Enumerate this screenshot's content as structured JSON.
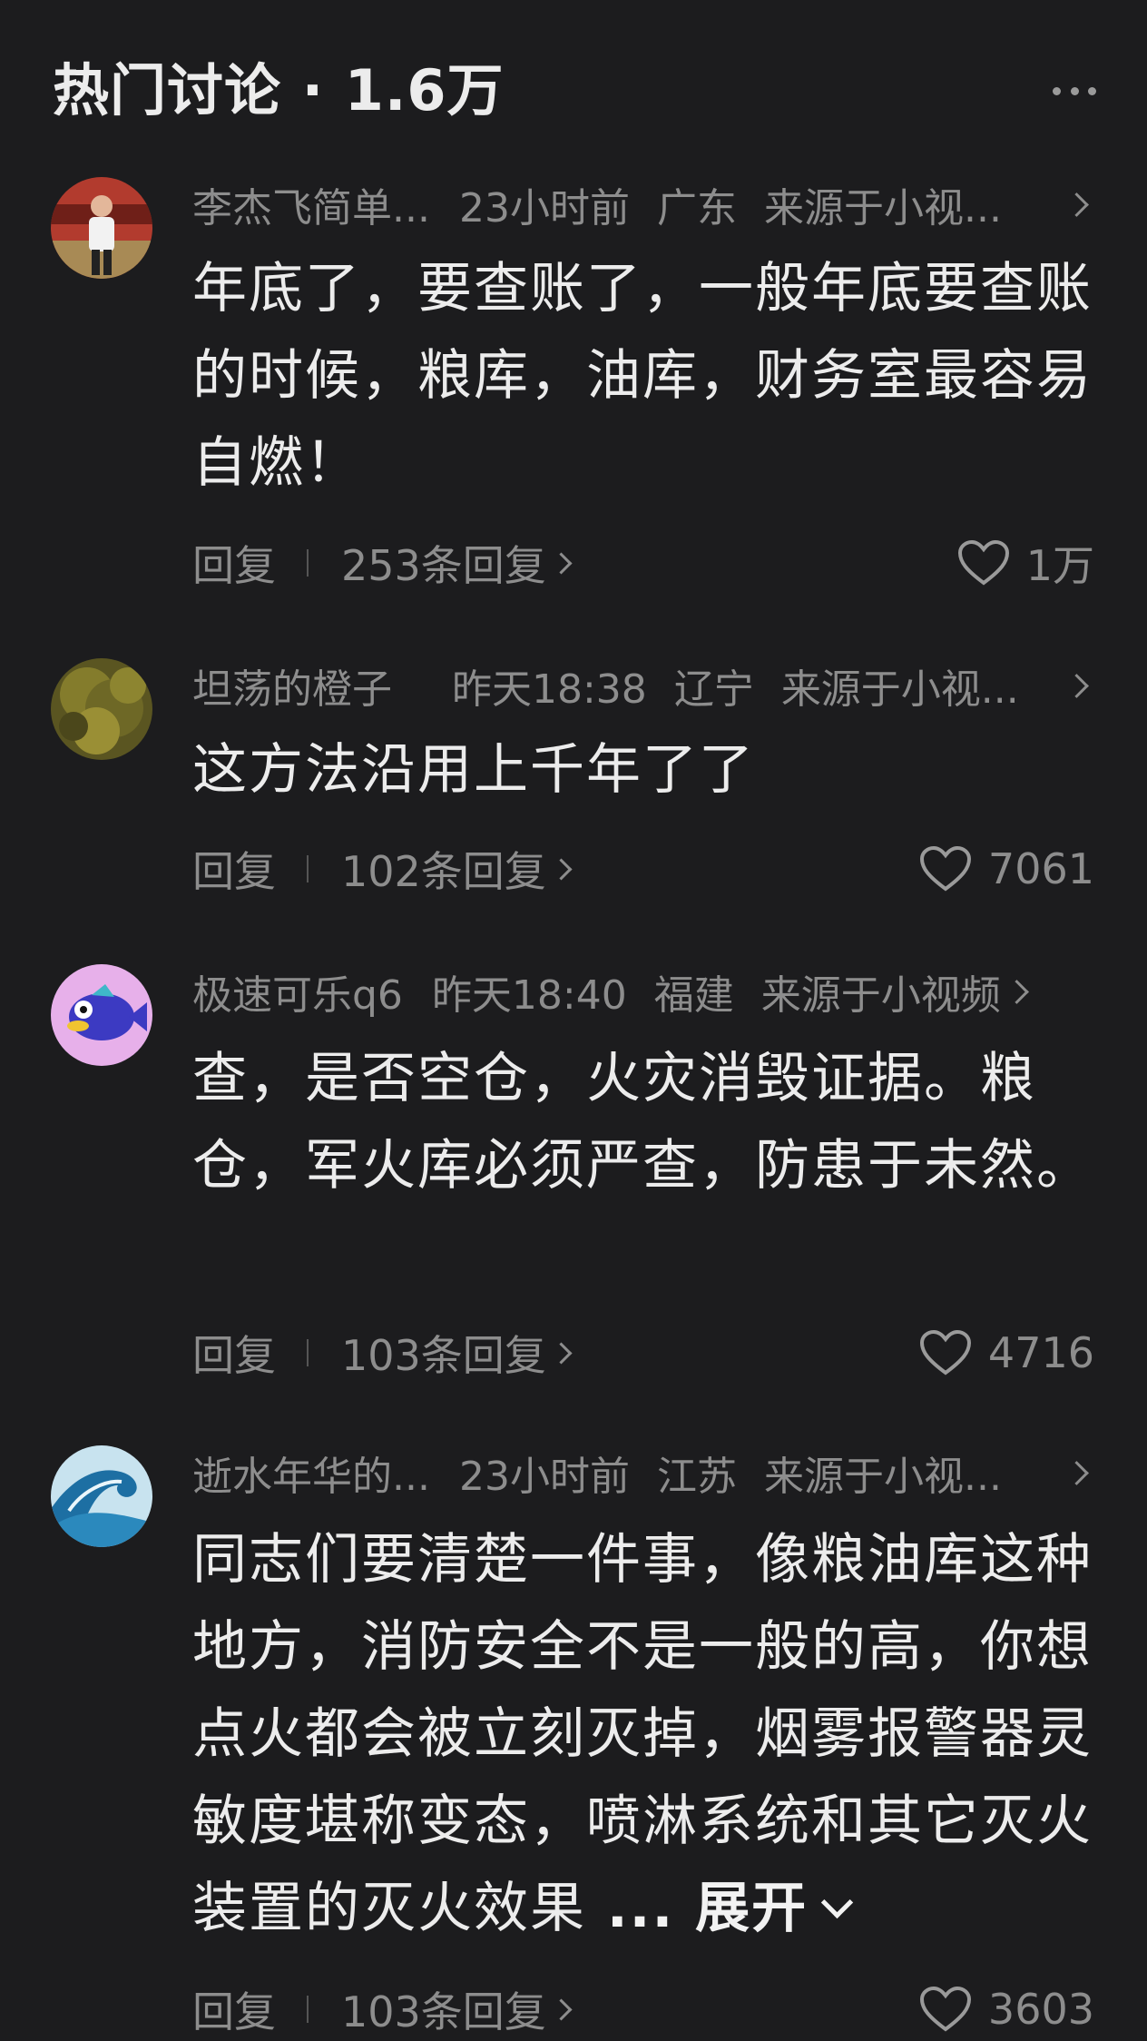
{
  "header": {
    "title": "热门讨论 · 1.6万"
  },
  "comments": [
    {
      "user": "李杰飞简单...",
      "time": "23小时前",
      "location": "广东",
      "source": "来源于小视...",
      "text": "年底了，要查账了，一般年底要查账的时候，粮库，油库，财务室最容易自燃！",
      "reply_label": "回复",
      "replies": "253条回复",
      "likes": "1万",
      "avatar_icon": "person-photo-avatar"
    },
    {
      "user": "坦荡的橙子",
      "time": "昨天18:38",
      "location": "辽宁",
      "source": "来源于小视...",
      "text": "这方法沿用上千年了了",
      "reply_label": "回复",
      "replies": "102条回复",
      "likes": "7061",
      "avatar_icon": "tree-photo-avatar"
    },
    {
      "user": "极速可乐q6",
      "time": "昨天18:40",
      "location": "福建",
      "source": "来源于小视频",
      "text": "查，是否空仓，火灾消毁证据。粮仓，军火库必须严查，防患于未然。",
      "reply_label": "回复",
      "replies": "103条回复",
      "likes": "4716",
      "avatar_icon": "fish-cartoon-avatar"
    },
    {
      "user": "逝水年华的...",
      "time": "23小时前",
      "location": "江苏",
      "source": "来源于小视...",
      "text": "同志们要清楚一件事，像粮油库这种地方，消防安全不是一般的高，你想点火都会被立刻灭掉，烟雾报警器灵敏度堪称变态，喷淋系统和其它灭火装置的灭火效果",
      "more_label": "... 展开",
      "reply_label": "回复",
      "replies": "103条回复",
      "likes": "3603",
      "avatar_icon": "wave-photo-avatar"
    }
  ],
  "colors": {
    "background": "#1c1c1e",
    "text": "#ececec",
    "muted": "#8d8d8d"
  }
}
